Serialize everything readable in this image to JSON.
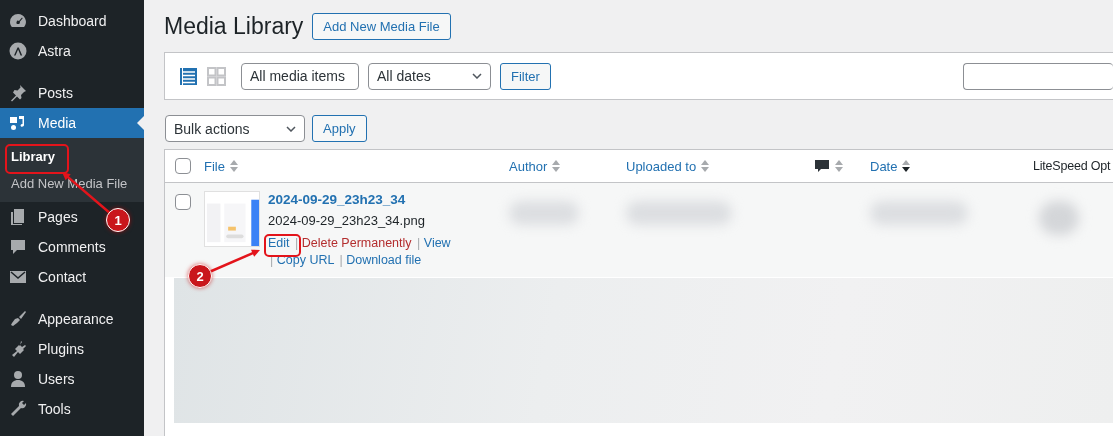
{
  "sidebar": {
    "items": [
      {
        "label": "Dashboard",
        "selected": false
      },
      {
        "label": "Astra",
        "selected": false
      },
      {
        "label": "Posts",
        "selected": false
      },
      {
        "label": "Media",
        "selected": true,
        "children": [
          {
            "label": "Library",
            "selected": true
          },
          {
            "label": "Add New Media File",
            "selected": false
          }
        ]
      },
      {
        "label": "Pages",
        "selected": false
      },
      {
        "label": "Comments",
        "selected": false
      },
      {
        "label": "Contact",
        "selected": false
      },
      {
        "label": "Appearance",
        "selected": false
      },
      {
        "label": "Plugins",
        "selected": false
      },
      {
        "label": "Users",
        "selected": false
      },
      {
        "label": "Tools",
        "selected": false
      }
    ]
  },
  "page": {
    "title": "Media Library",
    "add_button": "Add New Media File"
  },
  "filter_bar": {
    "views": [
      {
        "kind": "list",
        "selected": true
      },
      {
        "kind": "grid",
        "selected": false
      }
    ],
    "type_select": "All media items",
    "date_select": "All dates",
    "filter_button": "Filter"
  },
  "bulk": {
    "select": "Bulk actions",
    "apply_button": "Apply"
  },
  "table": {
    "select_all": {
      "checked": false
    },
    "columns": [
      {
        "kind": "sortable",
        "label": "File",
        "sorted": false
      },
      {
        "kind": "sortable",
        "label": "Author",
        "sorted": false
      },
      {
        "kind": "sortable",
        "label": "Uploaded to",
        "sorted": false
      },
      {
        "kind": "icon",
        "sorted": false
      },
      {
        "kind": "sortable",
        "label": "Date",
        "sorted": true
      },
      {
        "kind": "plain",
        "label": "LiteSpeed Opt"
      }
    ],
    "rows": [
      {
        "checked": false,
        "title": "2024-09-29_23h23_34",
        "filename": "2024-09-29_23h23_34.png",
        "actions": [
          {
            "label": "Edit",
            "kind": "link"
          },
          {
            "separator": "|",
            "label": "Delete Permanently",
            "kind": "danger"
          },
          {
            "separator": "|",
            "label": "View",
            "kind": "link"
          },
          {
            "separator": "|",
            "label": "Copy URL",
            "kind": "link"
          },
          {
            "separator": "|",
            "label": "Download file",
            "kind": "link"
          }
        ]
      }
    ]
  },
  "annotations": [
    {
      "number": "1"
    },
    {
      "number": "2"
    }
  ]
}
